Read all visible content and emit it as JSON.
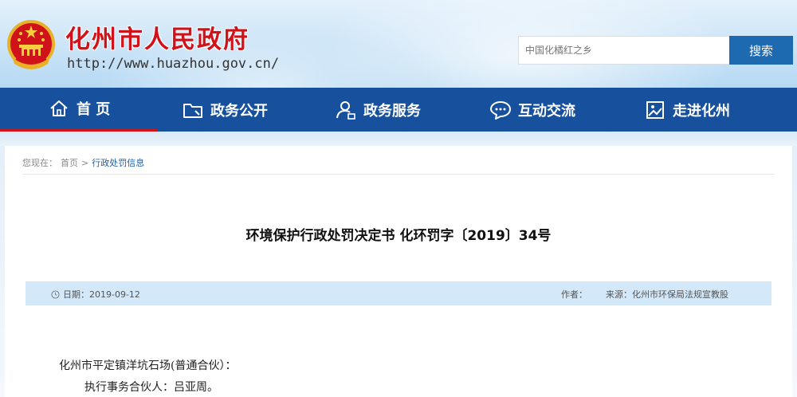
{
  "header": {
    "site_title": "化州市人民政府",
    "site_url": "http://www.huazhou.gov.cn/",
    "emblem_icon": "national-emblem-icon",
    "search": {
      "placeholder": "中国化橘红之乡",
      "button_label": "搜索"
    }
  },
  "nav": {
    "items": [
      {
        "label": "首 页",
        "icon": "home-icon"
      },
      {
        "label": "政务公开",
        "icon": "folder-icon"
      },
      {
        "label": "政务服务",
        "icon": "user-service-icon"
      },
      {
        "label": "互动交流",
        "icon": "chat-bubble-icon"
      },
      {
        "label": "走进化州",
        "icon": "picture-card-icon"
      }
    ],
    "active_index": 0
  },
  "breadcrumb": {
    "prefix": "您现在：",
    "home": "首页",
    "separator": ">",
    "current": "行政处罚信息"
  },
  "article": {
    "title": "环境保护行政处罚决定书 化环罚字〔2019〕34号",
    "meta": {
      "date_label": "日期：",
      "date": "2019-09-12",
      "author_label": "作者：",
      "source_label": "来源：",
      "source": "化州市环保局法规宣教股"
    },
    "paragraphs": [
      "化州市平定镇洋坑石场(普通合伙）：",
      "执行事务合伙人：吕亚周。"
    ]
  },
  "colors": {
    "brand_red": "#d0121b",
    "nav_blue": "#17519d",
    "search_blue": "#1d6ab0",
    "meta_bar": "#d3e8f8"
  }
}
